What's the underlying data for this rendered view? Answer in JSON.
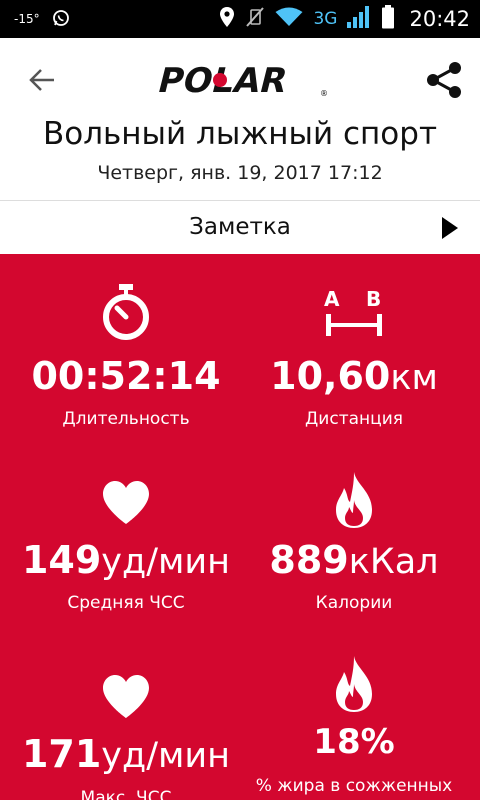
{
  "status_bar": {
    "temperature": "-15°",
    "network_type": "3G",
    "time": "20:42",
    "icons": [
      "whatsapp-icon",
      "location-icon",
      "mute-icon",
      "wifi-icon",
      "signal-icon",
      "battery-icon"
    ]
  },
  "app_bar": {
    "logo_text": "POLAR",
    "logo_mark": "®",
    "brand_color": "#d3072f"
  },
  "header": {
    "title": "Вольный лыжный спорт",
    "datetime": "Четверг, янв. 19, 2017 17:12"
  },
  "note": {
    "label": "Заметка"
  },
  "stats": [
    {
      "icon": "stopwatch-icon",
      "value": "00:52:14",
      "unit": "",
      "label": "Длительность"
    },
    {
      "icon": "distance-ab-icon",
      "value": "10,60",
      "unit": "км",
      "label": "Дистанция",
      "icon_text_a": "A",
      "icon_text_b": "B"
    },
    {
      "icon": "heart-icon",
      "value": "149",
      "unit": "уд/мин",
      "label": "Средняя ЧСС"
    },
    {
      "icon": "flame-icon",
      "value": "889",
      "unit": "кКал",
      "label": "Калории"
    },
    {
      "icon": "heart-icon",
      "value": "171",
      "unit": "уд/мин",
      "label": "Макс. ЧСС"
    },
    {
      "icon": "flame-icon",
      "value": "18%",
      "unit": "",
      "label": "% жира в сожженных"
    }
  ],
  "colors": {
    "panel_background": "#d3072f",
    "status_bar_background": "#000000",
    "network_indicator": "#4fc3f7"
  }
}
